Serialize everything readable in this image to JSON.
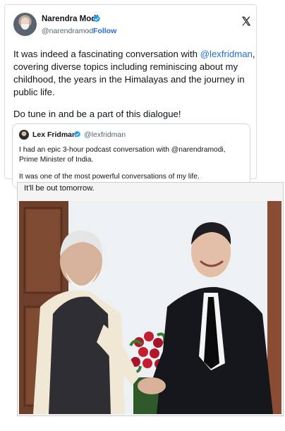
{
  "tweet": {
    "author_name": "Narendra Modi",
    "author_handle": "@narendramodi",
    "follow_separator": "·",
    "follow_label": "Follow",
    "text_part1": "It was indeed a fascinating conversation with ",
    "mention": "@lexfridman",
    "text_part2": ", covering diverse topics including reminiscing about my childhood, the years in the Himalayas and the journey in public life.",
    "text_second_paragraph": "Do tune in and be a part of this dialogue!"
  },
  "quoted_tweet": {
    "author_name": "Lex Fridman",
    "author_handle": "@lexfridman",
    "text_paragraph1": "I had an epic 3-hour podcast conversation with @narendramodi, Prime Minister of India.",
    "text_paragraph2": "It was one of the most powerful conversations of my life.",
    "text_paragraph3": "It'll be out tomorrow."
  },
  "colors": {
    "link_blue": "#1d6fd6",
    "verified_blue": "#1d9bf0",
    "text_dark": "#0f1419",
    "text_muted": "#536471"
  },
  "icons": {
    "verified": "verified-badge-icon",
    "platform": "x-logo-icon"
  }
}
